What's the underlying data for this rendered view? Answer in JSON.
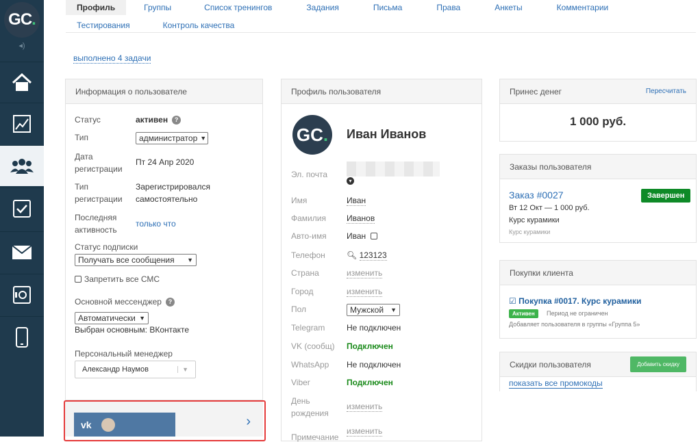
{
  "sidebar": {
    "logo_text": "GC",
    "logo_dot": ".",
    "items": [
      {
        "icon": "home-icon"
      },
      {
        "icon": "chart-icon"
      },
      {
        "icon": "users-icon",
        "active": true
      },
      {
        "icon": "checkbox-icon"
      },
      {
        "icon": "mail-icon"
      },
      {
        "icon": "safe-icon"
      },
      {
        "icon": "mobile-icon"
      }
    ]
  },
  "tabs": {
    "row1": [
      "Профиль",
      "Группы",
      "Список тренингов",
      "Задания",
      "Письма",
      "Права",
      "Анкеты",
      "Комментарии"
    ],
    "row2": [
      "Тестирования",
      "Контроль качества"
    ]
  },
  "tasks_done": "выполнено 4 задачи",
  "info": {
    "title": "Информация о пользователе",
    "status_label": "Статус",
    "status_value": "активен",
    "type_label": "Тип",
    "type_value": "администратор",
    "reg_date_label1": "Дата",
    "reg_date_label2": "регистрации",
    "reg_date_value": "Пт 24 Апр 2020",
    "reg_type_label1": "Тип",
    "reg_type_label2": "регистрации",
    "reg_type_value1": "Зарегистрировался",
    "reg_type_value2": "самостоятельно",
    "last_label1": "Последняя",
    "last_label2": "активность",
    "last_value": "только что",
    "subscription_label": "Статус подписки",
    "subscription_value": "Получать все сообщения",
    "sms_label": "Запретить все СМС",
    "messenger_label": "Основной мессенджер",
    "messenger_value": "Автоматически",
    "messenger_chosen": "Выбран основным: ВКонтакте",
    "manager_label": "Персональный менеджер",
    "manager_value": "Александр Наумов"
  },
  "vk_row": {
    "logo": "vk",
    "arrow": "›"
  },
  "profile": {
    "title": "Профиль пользователя",
    "avatar_text": "GC",
    "avatar_dot": ".",
    "name": "Иван Иванов",
    "fields": {
      "email_label": "Эл. почта",
      "first_label": "Имя",
      "first_value": "Иван",
      "last_label": "Фамилия",
      "last_value": "Иванов",
      "autoname_label": "Авто-имя",
      "autoname_value": "Иван",
      "phone_label": "Телефон",
      "phone_value": "123123",
      "country_label": "Страна",
      "country_value": "изменить",
      "city_label": "Город",
      "city_value": "изменить",
      "gender_label": "Пол",
      "gender_value": "Мужской",
      "telegram_label": "Telegram",
      "telegram_value": "Не подключен",
      "vk_label": "VK (сообщ)",
      "vk_value": "Подключен",
      "whatsapp_label": "WhatsApp",
      "whatsapp_value": "Не подключен",
      "viber_label": "Viber",
      "viber_value": "Подключен",
      "birthday_label1": "День",
      "birthday_label2": "рождения",
      "birthday_value": "изменить",
      "more_label": "Примечание",
      "more_value": "изменить"
    }
  },
  "money": {
    "title": "Принес денег",
    "recalc": "Пересчитать",
    "amount": "1 000 руб."
  },
  "orders": {
    "title": "Заказы пользователя",
    "order_link": "Заказ #0027",
    "badge": "Завершен",
    "line1": "Вт 12 Окт — 1 000 руб.",
    "line2": "Курс курамики",
    "line3": "Курс курамики"
  },
  "purchases": {
    "title": "Покупки клиента",
    "link": "Покупка #0017. Курс курамики",
    "badge": "Активен",
    "period": "Период не ограничен",
    "note": "Добавляет пользователя в группы «Группа 5»"
  },
  "discounts": {
    "title": "Скидки пользователя",
    "add_btn": "Добавить скидку",
    "show_link": "показать все промокоды"
  }
}
